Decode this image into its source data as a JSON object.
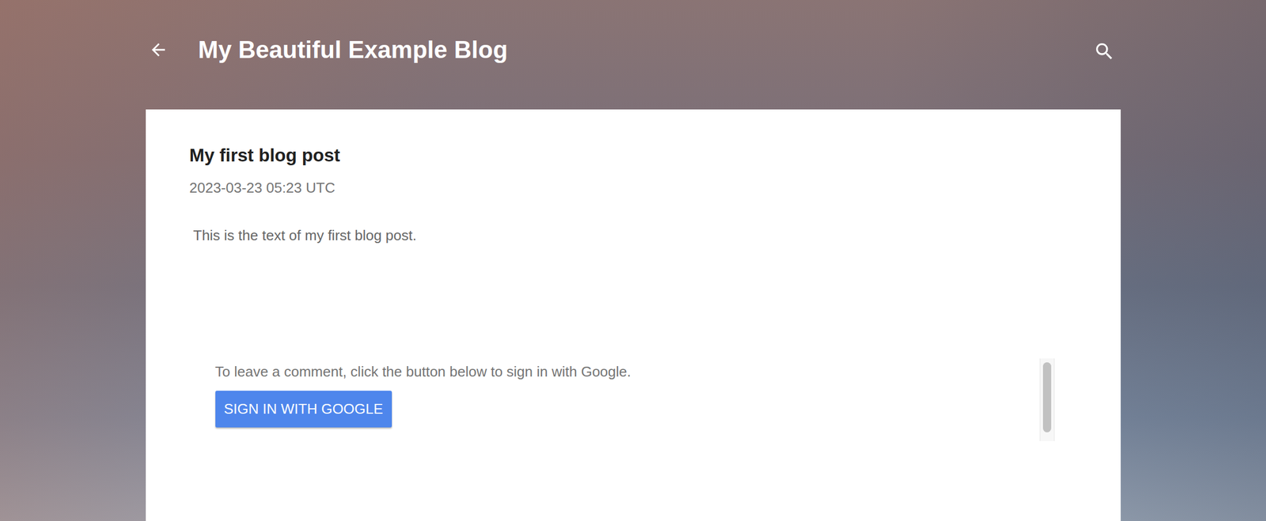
{
  "header": {
    "title": "My Beautiful Example Blog"
  },
  "post": {
    "title": "My first blog post",
    "date": "2023-03-23 05:23 UTC",
    "body": "This is the text of my first blog post."
  },
  "comments": {
    "prompt": "To leave a comment, click the button below to sign in with Google.",
    "button": "SIGN IN WITH GOOGLE"
  }
}
